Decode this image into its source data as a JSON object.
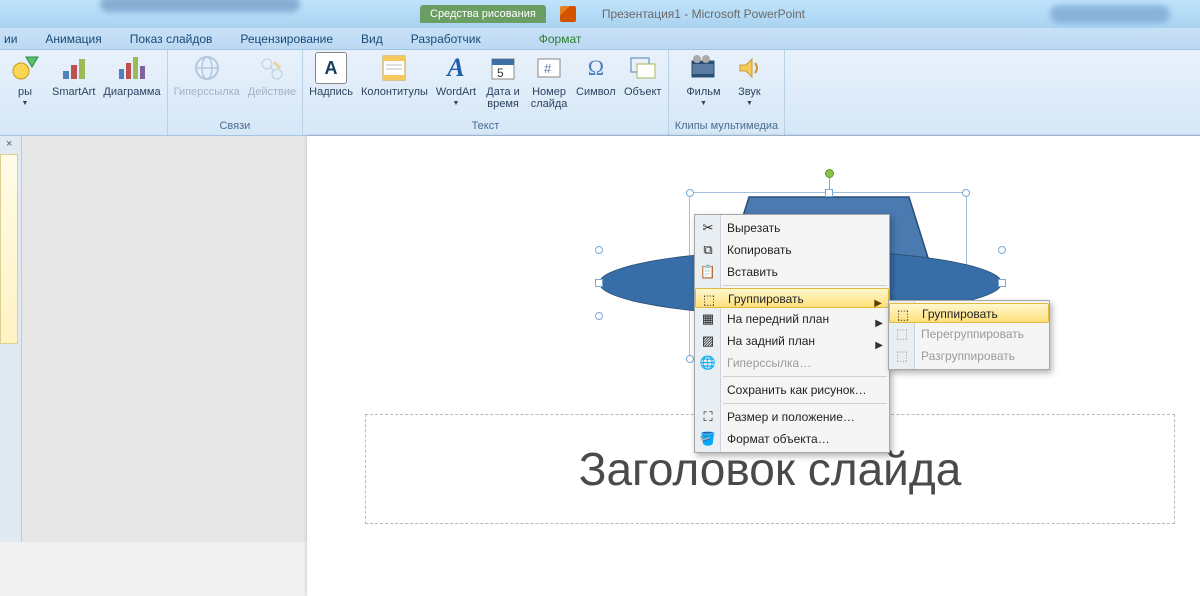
{
  "titlebar": {
    "context_tool": "Средства рисования",
    "doc_title": "Презентация1 - Microsoft PowerPoint"
  },
  "tabs": {
    "cut_left": "ии",
    "anim": "Анимация",
    "show": "Показ слайдов",
    "review": "Рецензирование",
    "view": "Вид",
    "dev": "Разработчик",
    "format": "Формат"
  },
  "ribbon": {
    "g1": {
      "label": "",
      "b1_l1": "ры",
      "b2": "SmartArt",
      "b3": "Диаграмма"
    },
    "g2": {
      "label": "Связи",
      "b1": "Гиперссылка",
      "b2": "Действие"
    },
    "g3": {
      "label": "Текст",
      "b1": "Надпись",
      "b2": "Колонтитулы",
      "b3": "WordArt",
      "b4a": "Дата и",
      "b4b": "время",
      "b5a": "Номер",
      "b5b": "слайда",
      "b6": "Символ",
      "b7": "Объект"
    },
    "g4": {
      "label": "Клипы мультимедиа",
      "b1": "Фильм",
      "b2": "Звук"
    }
  },
  "slide": {
    "title_placeholder": "Заголовок слайда"
  },
  "context_menu": {
    "cut": "Вырезать",
    "copy": "Копировать",
    "paste": "Вставить",
    "group": "Группировать",
    "front": "На передний план",
    "back": "На задний план",
    "link": "Гиперссылка…",
    "save_pic": "Сохранить как рисунок…",
    "size_pos": "Размер и положение…",
    "format_obj": "Формат объекта…"
  },
  "submenu": {
    "group": "Группировать",
    "regroup": "Перегруппировать",
    "ungroup": "Разгруппировать"
  }
}
